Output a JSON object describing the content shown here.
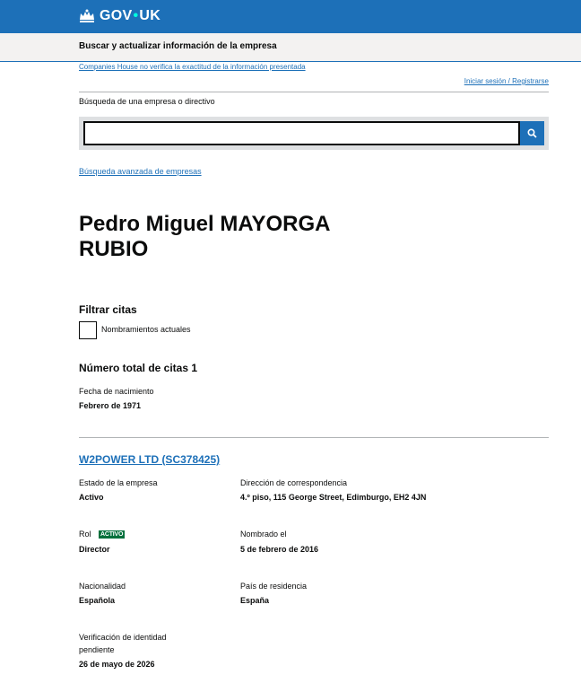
{
  "header": {
    "logo_text_a": "GOV",
    "logo_dot": "•",
    "logo_text_b": "UK",
    "service_name": "Buscar y actualizar información de la empresa"
  },
  "notices": {
    "disclaimer": "Companies House no verifica la exactitud de la información presentada",
    "signin": "Iniciar sesión / Registrarse"
  },
  "search": {
    "label": "Búsqueda de una empresa o directivo",
    "value": "",
    "placeholder": "",
    "advanced_link": "Búsqueda avanzada de empresas"
  },
  "officer": {
    "name_line1": "Pedro Miguel MAYORGA",
    "name_line2": "RUBIO"
  },
  "filter": {
    "title": "Filtrar citas",
    "checkbox_label": "Nombramientos actuales",
    "checked": false
  },
  "summary": {
    "total_label": "Número total de citas 1",
    "dob_label": "Fecha de nacimiento",
    "dob_value": "Febrero de 1971"
  },
  "appointment": {
    "company_link": "W2POWER LTD (SC378425)",
    "status_label": "Estado de la empresa",
    "status_value": "Activo",
    "address_label": "Dirección de correspondencia",
    "address_value": "4.º piso, 115 George Street, Edimburgo, EH2 4JN",
    "role_label": "Rol",
    "role_badge": "ACTIVO",
    "role_value": "Director",
    "appointed_label": "Nombrado el",
    "appointed_value": "5 de febrero de 2016",
    "nationality_label": "Nacionalidad",
    "nationality_value": "Española",
    "residence_label": "País de residencia",
    "residence_value": "España",
    "verification_label_line1": "Verificación de identidad",
    "verification_label_line2": "pendiente",
    "verification_value": "26 de mayo de 2026"
  },
  "colors": {
    "brand_blue": "#1d70b8",
    "badge_green": "#00703c",
    "text": "#0b0c0c"
  },
  "icons": {
    "logo": "crown-icon",
    "search_button": "search-icon"
  }
}
